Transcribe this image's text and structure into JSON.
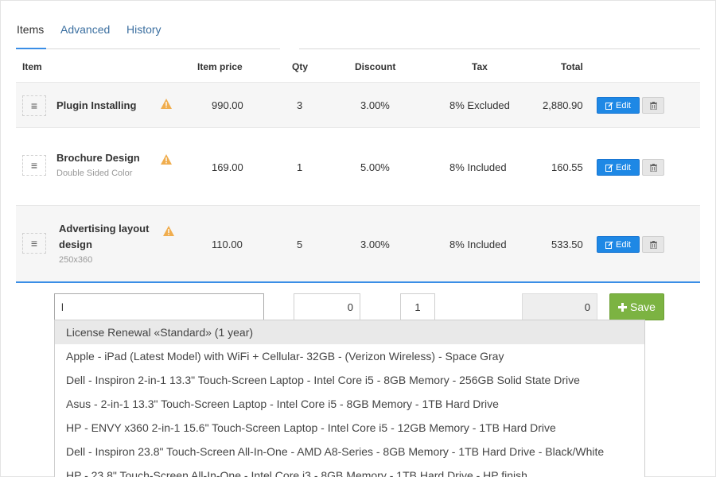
{
  "tabs": [
    {
      "label": "Items",
      "active": true
    },
    {
      "label": "Advanced",
      "active": false
    },
    {
      "label": "History",
      "active": false
    }
  ],
  "columns": {
    "item": "Item",
    "price": "Item price",
    "qty": "Qty",
    "discount": "Discount",
    "tax": "Tax",
    "total": "Total"
  },
  "rows": [
    {
      "name": "Plugin Installing",
      "desc": "",
      "price": "990.00",
      "qty": "3",
      "discount": "3.00%",
      "tax": "8% Excluded",
      "total": "2,880.90"
    },
    {
      "name": "Brochure Design",
      "desc": "Double Sided Color",
      "price": "169.00",
      "qty": "1",
      "discount": "5.00%",
      "tax": "8% Included",
      "total": "160.55"
    },
    {
      "name": "Advertising layout design",
      "desc": "250x360",
      "price": "110.00",
      "qty": "5",
      "discount": "3.00%",
      "tax": "8% Included",
      "total": "533.50"
    }
  ],
  "actions": {
    "edit_label": "Edit"
  },
  "new_item": {
    "search_value": "l",
    "price_value": "0",
    "qty_value": "1",
    "total_value": "0",
    "save_label": "Save"
  },
  "suggestions": [
    "License Renewal «Standard» (1 year)",
    "Apple - iPad (Latest Model) with WiFi + Cellular- 32GB - (Verizon Wireless) - Space Gray",
    "Dell - Inspiron 2-in-1 13.3\" Touch-Screen Laptop - Intel Core i5 - 8GB Memory - 256GB Solid State Drive",
    "Asus - 2-in-1 13.3\" Touch-Screen Laptop - Intel Core i5 - 8GB Memory - 1TB Hard Drive",
    "HP - ENVY x360 2-in-1 15.6\" Touch-Screen Laptop - Intel Core i5 - 12GB Memory - 1TB Hard Drive",
    "Dell - Inspiron 23.8\" Touch-Screen All-In-One - AMD A8-Series - 8GB Memory - 1TB Hard Drive - Black/White",
    "HP - 23.8\" Touch-Screen All-In-One - Intel Core i3 - 8GB Memory - 1TB Hard Drive - HP finish"
  ],
  "colors": {
    "accent": "#3a8ee6",
    "edit_button": "#1e88e5",
    "save_button": "#7cb342",
    "warning": "#f0ad4e",
    "row_alt": "#f6f6f6"
  },
  "icons": {
    "drag": "drag-handle-icon",
    "warning": "warning-icon",
    "edit": "edit-icon",
    "delete": "trash-icon",
    "save": "plus-icon"
  }
}
